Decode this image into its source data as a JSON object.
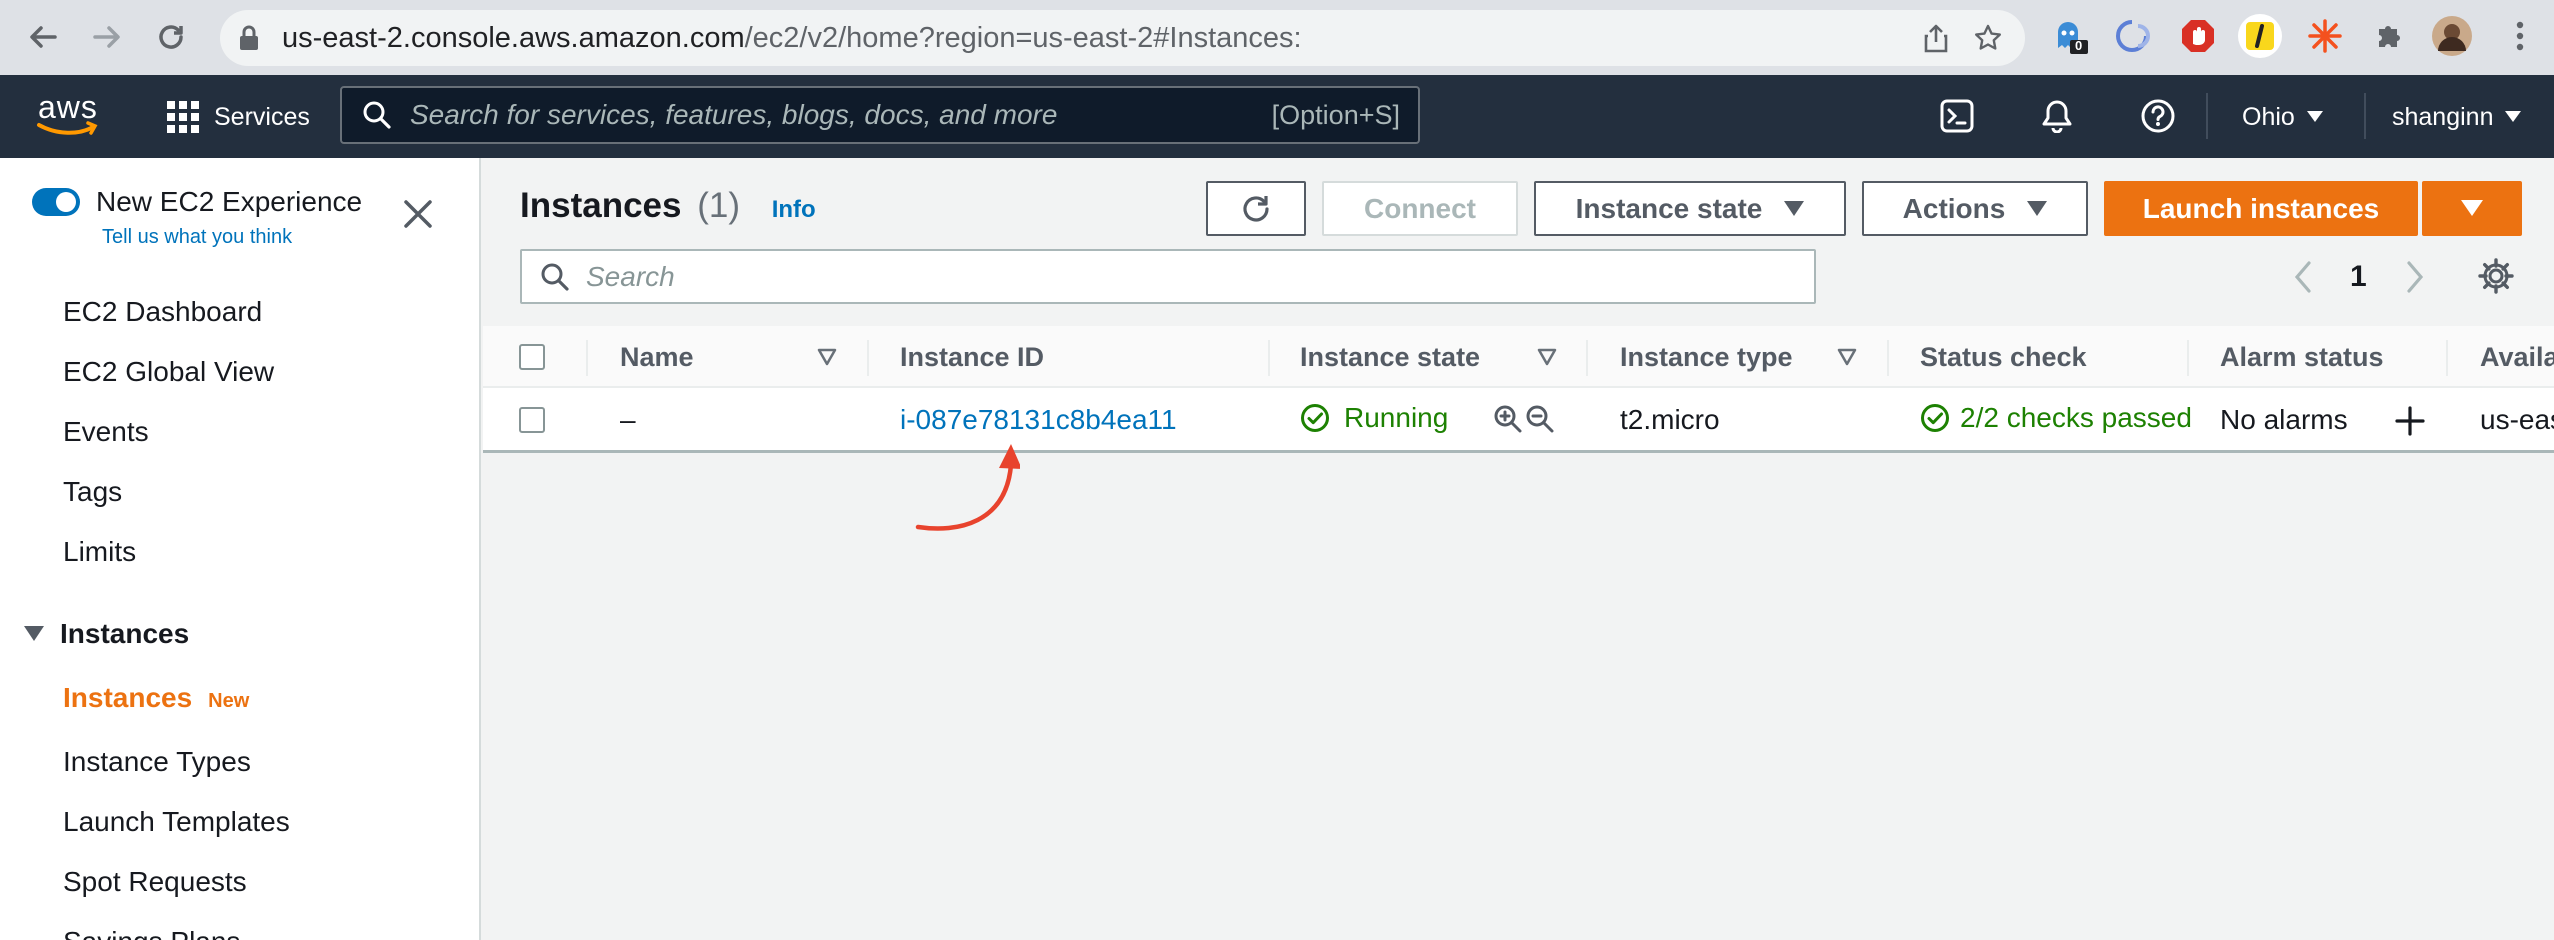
{
  "browser": {
    "url_host": "us-east-2.console.aws.amazon.com",
    "url_path": "/ec2/v2/home?region=us-east-2#Instances:",
    "ext_badge": "0"
  },
  "aws_header": {
    "logo_text": "aws",
    "services_label": "Services",
    "search_placeholder": "Search for services, features, blogs, docs, and more",
    "search_shortcut": "[Option+S]",
    "region": "Ohio",
    "user": "shanginn"
  },
  "sidebar": {
    "toggle_label": "New EC2 Experience",
    "feedback_link": "Tell us what you think",
    "items": [
      "EC2 Dashboard",
      "EC2 Global View",
      "Events",
      "Tags",
      "Limits"
    ],
    "section_title": "Instances",
    "sub_items": [
      {
        "label": "Instances",
        "badge": "New",
        "active": true
      },
      {
        "label": "Instance Types"
      },
      {
        "label": "Launch Templates"
      },
      {
        "label": "Spot Requests"
      },
      {
        "label": "Savings Plans"
      }
    ]
  },
  "main": {
    "title": "Instances",
    "count": "(1)",
    "info_link": "Info",
    "buttons": {
      "connect": "Connect",
      "instance_state": "Instance state",
      "actions": "Actions",
      "launch": "Launch instances"
    },
    "search_placeholder": "Search",
    "page_number": "1"
  },
  "table": {
    "columns": [
      "Name",
      "Instance ID",
      "Instance state",
      "Instance type",
      "Status check",
      "Alarm status",
      "Availability Zone"
    ],
    "column_visible_text": [
      "Name",
      "Instance ID",
      "Instance state",
      "Instance type",
      "Status check",
      "Alarm status",
      "Availa"
    ],
    "rows": [
      {
        "name": "–",
        "instance_id": "i-087e78131c8b4ea11",
        "state": "Running",
        "type": "t2.micro",
        "status_check": "2/2 checks passed",
        "alarm_status": "No alarms",
        "availability_zone": "us-eas"
      }
    ]
  },
  "colors": {
    "aws_header": "#232f3e",
    "accent_orange": "#ec7211",
    "link_blue": "#0073bb",
    "success_green": "#1d8102",
    "annotation_red": "#e8432d"
  }
}
